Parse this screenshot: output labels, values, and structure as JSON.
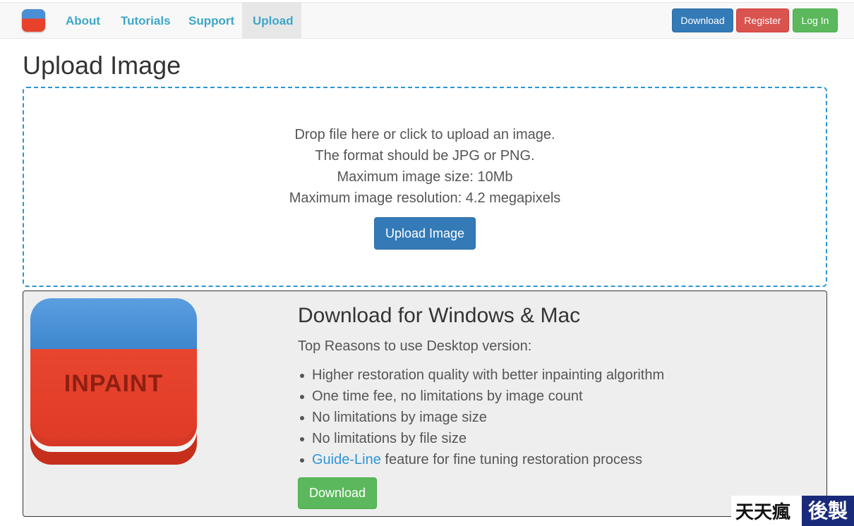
{
  "nav": {
    "items": [
      {
        "label": "About"
      },
      {
        "label": "Tutorials"
      },
      {
        "label": "Support"
      },
      {
        "label": "Upload",
        "active": true
      }
    ],
    "download_label": "Download",
    "register_label": "Register",
    "login_label": "Log In"
  },
  "page": {
    "title": "Upload Image"
  },
  "dropzone": {
    "lines": [
      "Drop file here or click to upload an image.",
      "The format should be JPG or PNG.",
      "Maximum image size: 10Mb",
      "Maximum image resolution: 4.2 megapixels"
    ],
    "button_label": "Upload Image"
  },
  "promo": {
    "icon_text": "INPAINT",
    "title": "Download for Windows & Mac",
    "subtitle": "Top Reasons to use Desktop version:",
    "reasons": [
      "Higher restoration quality with better inpainting algorithm",
      "One time fee, no limitations by image count",
      "No limitations by image size",
      "No limitations by file size"
    ],
    "guide_link": "Guide-Line",
    "guide_rest": " feature for fine tuning restoration process",
    "download_label": "Download"
  },
  "watermark": {
    "left": "天天瘋",
    "right": "後製"
  },
  "colors": {
    "nav_link": "#3fa7c8",
    "primary": "#337ab7",
    "danger": "#d9534f",
    "success": "#5cb85c",
    "dropzone_border": "#2d95d6"
  }
}
